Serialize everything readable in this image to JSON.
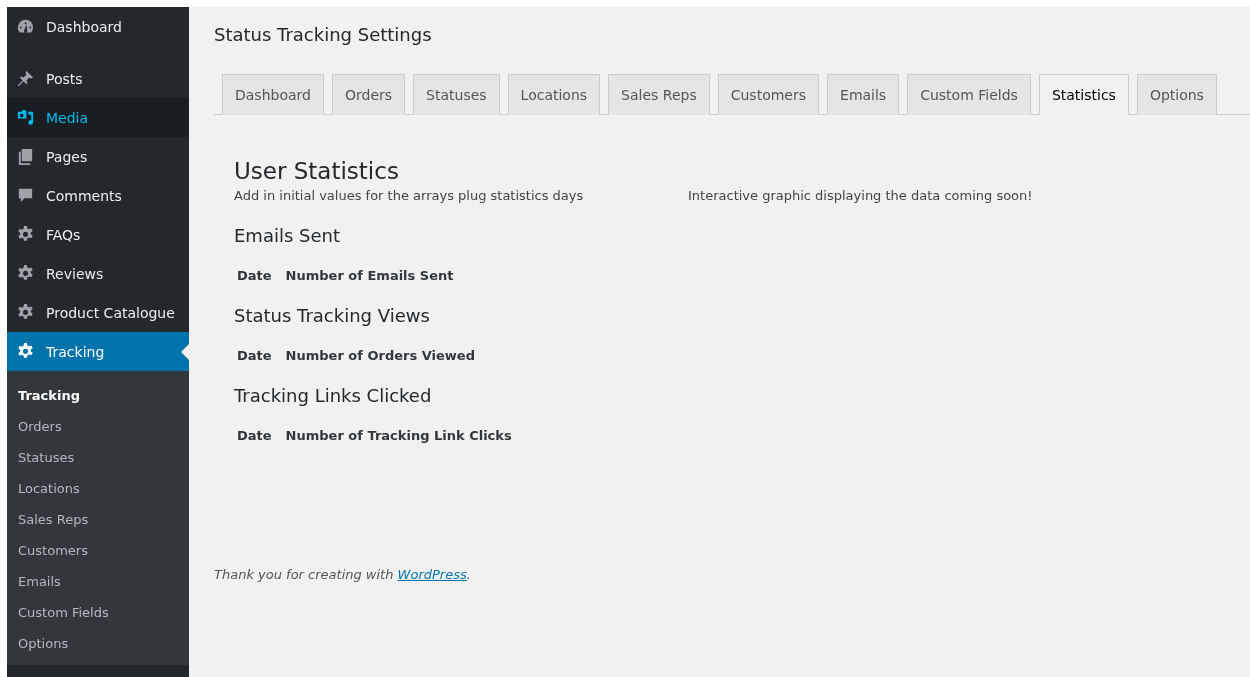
{
  "sidebar": {
    "items": [
      {
        "label": "Dashboard",
        "kind": "gauge",
        "selected": false,
        "hover": false
      },
      {
        "label": "Posts",
        "kind": "pin",
        "selected": false,
        "hover": false
      },
      {
        "label": "Media",
        "kind": "media",
        "selected": false,
        "hover": true
      },
      {
        "label": "Pages",
        "kind": "pages",
        "selected": false,
        "hover": false
      },
      {
        "label": "Comments",
        "kind": "comment",
        "selected": false,
        "hover": false
      },
      {
        "label": "FAQs",
        "kind": "gear",
        "selected": false,
        "hover": false
      },
      {
        "label": "Reviews",
        "kind": "gear",
        "selected": false,
        "hover": false
      },
      {
        "label": "Product Catalogue",
        "kind": "gear",
        "selected": false,
        "hover": false
      },
      {
        "label": "Tracking",
        "kind": "gear",
        "selected": true,
        "hover": false
      }
    ],
    "submenu": [
      {
        "label": "Tracking",
        "selected": true
      },
      {
        "label": "Orders",
        "selected": false
      },
      {
        "label": "Statuses",
        "selected": false
      },
      {
        "label": "Locations",
        "selected": false
      },
      {
        "label": "Sales Reps",
        "selected": false
      },
      {
        "label": "Customers",
        "selected": false
      },
      {
        "label": "Emails",
        "selected": false
      },
      {
        "label": "Custom Fields",
        "selected": false
      },
      {
        "label": "Options",
        "selected": false
      }
    ]
  },
  "page_title": "Status Tracking Settings",
  "tabs": [
    {
      "label": "Dashboard",
      "selected": false
    },
    {
      "label": "Orders",
      "selected": false
    },
    {
      "label": "Statuses",
      "selected": false
    },
    {
      "label": "Locations",
      "selected": false
    },
    {
      "label": "Sales Reps",
      "selected": false
    },
    {
      "label": "Customers",
      "selected": false
    },
    {
      "label": "Emails",
      "selected": false
    },
    {
      "label": "Custom Fields",
      "selected": false
    },
    {
      "label": "Statistics",
      "selected": true
    },
    {
      "label": "Options",
      "selected": false
    }
  ],
  "content": {
    "heading": "User Statistics",
    "description": "Add in initial values for the arrays plug statistics days",
    "note": "Interactive graphic displaying the data coming soon!",
    "sections": [
      {
        "title": "Emails Sent",
        "columns": [
          "Date",
          "Number of Emails Sent"
        ]
      },
      {
        "title": "Status Tracking Views",
        "columns": [
          "Date",
          "Number of Orders Viewed"
        ]
      },
      {
        "title": "Tracking Links Clicked",
        "columns": [
          "Date",
          "Number of Tracking Link Clicks"
        ]
      }
    ]
  },
  "footer": {
    "text": "Thank you for creating with ",
    "link": "WordPress",
    "after": "."
  }
}
